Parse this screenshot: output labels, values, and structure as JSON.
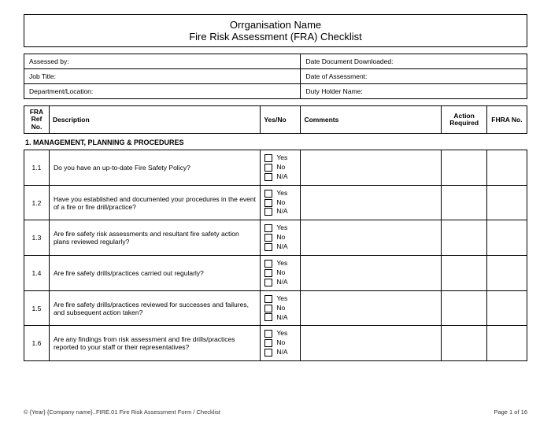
{
  "title": {
    "line1": "Orrganisation Name",
    "line2": "Fire Risk Assessment (FRA) Checklist"
  },
  "meta": {
    "assessed_by": "Assessed by:",
    "date_downloaded": "Date Document Downloaded:",
    "job_title": "Job Title:",
    "date_assessment": "Date of Assessment:",
    "dept": "Department/Location:",
    "duty_holder": "Duty Holder Name:"
  },
  "headers": {
    "ref": "FRA Ref No.",
    "desc": "Description",
    "yn": "Yes/No",
    "comm": "Comments",
    "act": "Action Required",
    "fhra": "FHRA No."
  },
  "section": "1. MANAGEMENT, PLANNING & PROCEDURES",
  "opts": {
    "yes": "Yes",
    "no": "No",
    "na": "N/A"
  },
  "rows": [
    {
      "ref": "1.1",
      "desc": "Do you have an up-to-date Fire Safety Policy?"
    },
    {
      "ref": "1.2",
      "desc": "Have you established and documented your procedures in the event of a fire or fire drill/practice?"
    },
    {
      "ref": "1.3",
      "desc": "Are fire safety risk assessments and resultant fire safety action plans reviewed regularly?"
    },
    {
      "ref": "1.4",
      "desc": "Are fire safety drills/practices carried out regularly?"
    },
    {
      "ref": "1.5",
      "desc": "Are fire safety drills/practices reviewed for successes and failures, and subsequent action taken?"
    },
    {
      "ref": "1.6",
      "desc": "Are any findings from risk assessment and fire drills/practices reported to your staff or their representatives?"
    }
  ],
  "footer": {
    "left": "© {Year} {Company name}..FIRE.01 Fire Risk Assessment Form / Checklist",
    "right": "Page 1 of 16"
  }
}
